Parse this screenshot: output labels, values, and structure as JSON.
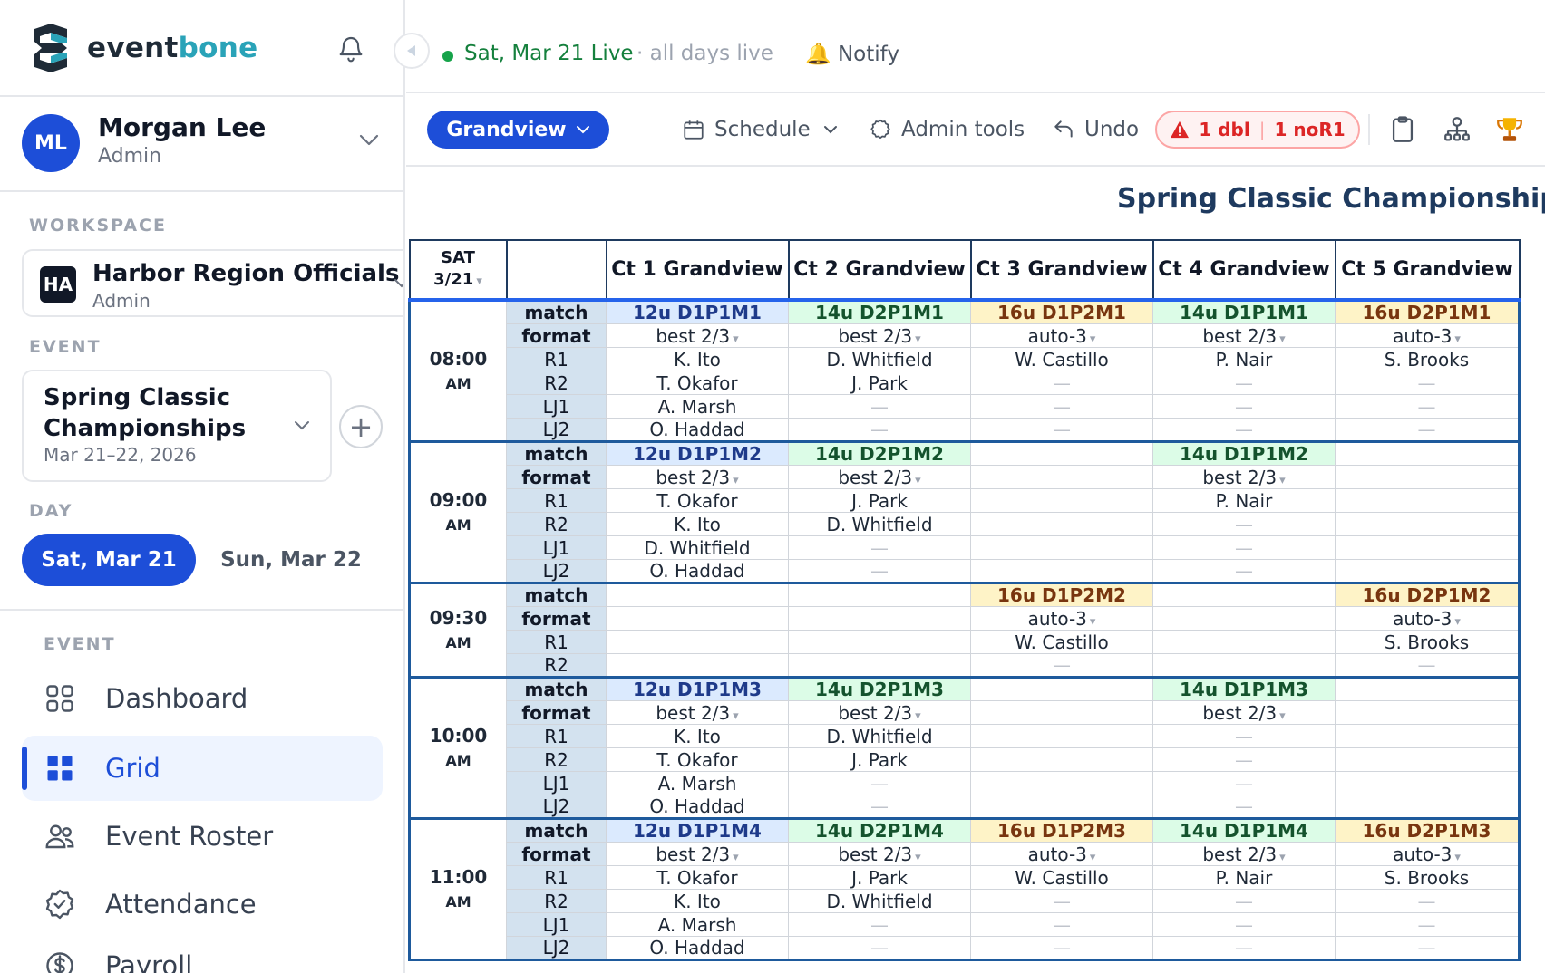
{
  "brand": {
    "part1": "event",
    "part2": "bone",
    "colors": {
      "dark": "#1f2b37",
      "accent": "#2aa3b8"
    }
  },
  "user": {
    "initials": "ML",
    "name": "Morgan Lee",
    "role": "Admin"
  },
  "workspace": {
    "section_label": "WORKSPACE",
    "initials": "HA",
    "name": "Harbor Region Officials",
    "role": "Admin"
  },
  "event": {
    "section_label": "EVENT",
    "name": "Spring Classic Championships",
    "dates": "Mar 21–22, 2026",
    "add_icon": "+"
  },
  "day": {
    "section_label": "DAY",
    "active": "Sat, Mar 21",
    "other": "Sun, Mar 22"
  },
  "nav": {
    "section_label": "EVENT",
    "items": [
      {
        "label": "Dashboard",
        "icon": "dashboard-icon"
      },
      {
        "label": "Grid",
        "icon": "grid-icon",
        "active": true
      },
      {
        "label": "Event Roster",
        "icon": "users-icon"
      },
      {
        "label": "Attendance",
        "icon": "check-badge-icon"
      },
      {
        "label": "Payroll",
        "icon": "dollar-icon"
      }
    ]
  },
  "topbar": {
    "live_text": "Sat, Mar 21 Live",
    "live_sub": "· all days live",
    "notify": "🔔 Notify",
    "venue": "Grandview",
    "schedule": "Schedule",
    "admin_tools": "Admin tools",
    "undo": "Undo",
    "alert_dbl": "1 dbl",
    "alert_sep": "|",
    "alert_nor1": "1 noR1"
  },
  "grid": {
    "title": "Spring Classic Championships",
    "day_header": {
      "line1": "SAT",
      "line2": "3/21",
      "caret": "▾"
    },
    "courts": [
      "Ct 1 Grandview",
      "Ct 2 Grandview",
      "Ct 3 Grandview",
      "Ct 4 Grandview",
      "Ct 5 Grandview"
    ],
    "caret": "▾",
    "dash": "—",
    "blocks": [
      {
        "time": "08:00",
        "ampm": "AM",
        "rows": [
          {
            "label": "match",
            "cells": [
              "12u D1P1M1",
              "14u D2P1M1",
              "16u D1P2M1",
              "14u D1P1M1",
              "16u D2P1M1"
            ]
          },
          {
            "label": "format",
            "cells": [
              "best 2/3",
              "best 2/3",
              "auto-3",
              "best 2/3",
              "auto-3"
            ]
          },
          {
            "label": "R1",
            "cells": [
              "K. Ito",
              "D. Whitfield",
              "W. Castillo",
              "P. Nair",
              "S. Brooks"
            ]
          },
          {
            "label": "R2",
            "cells": [
              "T. Okafor",
              "J. Park",
              "—",
              "—",
              "—"
            ]
          },
          {
            "label": "LJ1",
            "cells": [
              "A. Marsh",
              "—",
              "—",
              "—",
              "—"
            ]
          },
          {
            "label": "LJ2",
            "cells": [
              "O. Haddad",
              "—",
              "—",
              "—",
              "—"
            ]
          }
        ]
      },
      {
        "time": "09:00",
        "ampm": "AM",
        "rows": [
          {
            "label": "match",
            "cells": [
              "12u D1P1M2",
              "14u D2P1M2",
              "",
              "14u D1P1M2",
              ""
            ]
          },
          {
            "label": "format",
            "cells": [
              "best 2/3",
              "best 2/3",
              "",
              "best 2/3",
              ""
            ]
          },
          {
            "label": "R1",
            "cells": [
              "T. Okafor",
              "J. Park",
              "",
              "P. Nair",
              ""
            ]
          },
          {
            "label": "R2",
            "cells": [
              "K. Ito",
              "D. Whitfield",
              "",
              "—",
              ""
            ]
          },
          {
            "label": "LJ1",
            "cells": [
              "D. Whitfield",
              "—",
              "",
              "—",
              ""
            ]
          },
          {
            "label": "LJ2",
            "cells": [
              "O. Haddad",
              "—",
              "",
              "—",
              ""
            ]
          }
        ]
      },
      {
        "time": "09:30",
        "ampm": "AM",
        "rows": [
          {
            "label": "match",
            "cells": [
              "",
              "",
              "16u D1P2M2",
              "",
              "16u D2P1M2"
            ]
          },
          {
            "label": "format",
            "cells": [
              "",
              "",
              "auto-3",
              "",
              "auto-3"
            ]
          },
          {
            "label": "R1",
            "cells": [
              "",
              "",
              "W. Castillo",
              "",
              "S. Brooks"
            ]
          },
          {
            "label": "R2",
            "cells": [
              "",
              "",
              "—",
              "",
              "—"
            ]
          }
        ]
      },
      {
        "time": "10:00",
        "ampm": "AM",
        "rows": [
          {
            "label": "match",
            "cells": [
              "12u D1P1M3",
              "14u D2P1M3",
              "",
              "14u D1P1M3",
              ""
            ]
          },
          {
            "label": "format",
            "cells": [
              "best 2/3",
              "best 2/3",
              "",
              "best 2/3",
              ""
            ]
          },
          {
            "label": "R1",
            "cells": [
              "K. Ito",
              "D. Whitfield",
              "",
              "—",
              ""
            ]
          },
          {
            "label": "R2",
            "cells": [
              "T. Okafor",
              "J. Park",
              "",
              "—",
              ""
            ]
          },
          {
            "label": "LJ1",
            "cells": [
              "A. Marsh",
              "—",
              "",
              "—",
              ""
            ]
          },
          {
            "label": "LJ2",
            "cells": [
              "O. Haddad",
              "—",
              "",
              "—",
              ""
            ]
          }
        ]
      },
      {
        "time": "11:00",
        "ampm": "AM",
        "rows": [
          {
            "label": "match",
            "cells": [
              "12u D1P1M4",
              "14u D2P1M4",
              "16u D1P2M3",
              "14u D1P1M4",
              "16u D2P1M3"
            ]
          },
          {
            "label": "format",
            "cells": [
              "best 2/3",
              "best 2/3",
              "auto-3",
              "best 2/3",
              "auto-3"
            ]
          },
          {
            "label": "R1",
            "cells": [
              "T. Okafor",
              "J. Park",
              "W. Castillo",
              "P. Nair",
              "S. Brooks"
            ]
          },
          {
            "label": "R2",
            "cells": [
              "K. Ito",
              "D. Whitfield",
              "—",
              "—",
              "—"
            ]
          },
          {
            "label": "LJ1",
            "cells": [
              "A. Marsh",
              "—",
              "—",
              "—",
              "—"
            ]
          },
          {
            "label": "LJ2",
            "cells": [
              "O. Haddad",
              "—",
              "—",
              "—",
              "—"
            ]
          }
        ]
      }
    ]
  },
  "colors": {
    "primary": "#1d4ed8",
    "live": "#16a34a",
    "alert": "#dc2626",
    "m12": "#dbeafe",
    "m14": "#dcfce7",
    "m16": "#fef3c7",
    "label_bg": "#d3e2ef"
  }
}
